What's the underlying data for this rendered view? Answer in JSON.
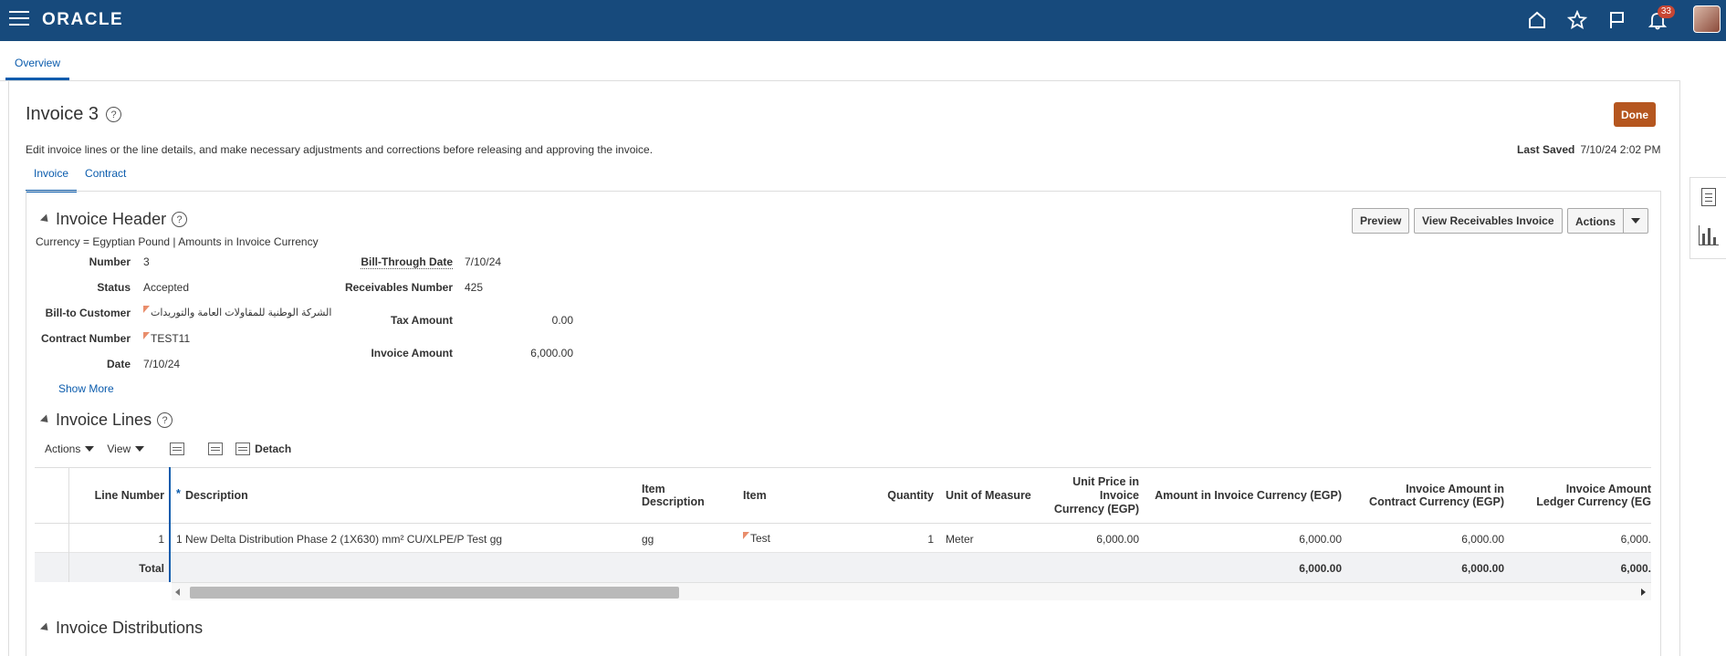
{
  "header": {
    "logo": "ORACLE",
    "notification_count": "33"
  },
  "page_tab": "Overview",
  "invoice": {
    "title": "Invoice 3",
    "help": "?",
    "done_label": "Done",
    "description": "Edit invoice lines or the line details, and make necessary adjustments and corrections before releasing and approving the invoice.",
    "last_saved_label": "Last Saved",
    "last_saved_value": "7/10/24 2:02 PM",
    "tabs": [
      "Invoice",
      "Contract"
    ]
  },
  "header_section": {
    "title": "Invoice Header",
    "currency_note": "Currency = Egyptian Pound | Amounts in Invoice Currency",
    "buttons": {
      "preview": "Preview",
      "view_receivables": "View Receivables Invoice",
      "actions": "Actions"
    },
    "fields": {
      "number_label": "Number",
      "number": "3",
      "status_label": "Status",
      "status": "Accepted",
      "bill_to_label": "Bill-to Customer",
      "bill_to": "الشركة الوطنية للمقاولات العامة والتوريدات",
      "contract_label": "Contract Number",
      "contract": "TEST11",
      "date_label": "Date",
      "date": "7/10/24",
      "bill_through_label": "Bill-Through Date",
      "bill_through": "7/10/24",
      "receivables_label": "Receivables Number",
      "receivables": "425",
      "tax_label": "Tax Amount",
      "tax": "0.00",
      "invoice_amount_label": "Invoice Amount",
      "invoice_amount": "6,000.00"
    },
    "show_more": "Show More"
  },
  "lines_section": {
    "title": "Invoice Lines",
    "toolbar": {
      "actions": "Actions",
      "view": "View",
      "detach": "Detach"
    },
    "columns": {
      "line_number": "Line Number",
      "required": "*",
      "description": "Description",
      "item_desc_1": "Item",
      "item_desc_2": "Description",
      "item": "Item",
      "quantity": "Quantity",
      "uom": "Unit of Measure",
      "unit_price_1": "Unit Price in",
      "unit_price_2": "Invoice",
      "unit_price_3": "Currency (EGP)",
      "amount_inv": "Amount in Invoice Currency (EGP)",
      "amount_contract_1": "Invoice Amount in",
      "amount_contract_2": "Contract Currency (EGP)",
      "amount_ledger_1": "Invoice Amount",
      "amount_ledger_2": "Ledger Currency (EG"
    },
    "rows": [
      {
        "line_number": "1",
        "description": "1 New Delta Distribution Phase 2 (1X630) mm² CU/XLPE/P Test gg",
        "item_description": "gg",
        "item": "Test",
        "quantity": "1",
        "uom": "Meter",
        "unit_price": "6,000.00",
        "amount_inv": "6,000.00",
        "amount_contract": "6,000.00",
        "amount_ledger": "6,000."
      }
    ],
    "total": {
      "label": "Total",
      "amount_inv": "6,000.00",
      "amount_contract": "6,000.00",
      "amount_ledger": "6,000."
    }
  },
  "distributions_section": {
    "title": "Invoice Distributions"
  }
}
